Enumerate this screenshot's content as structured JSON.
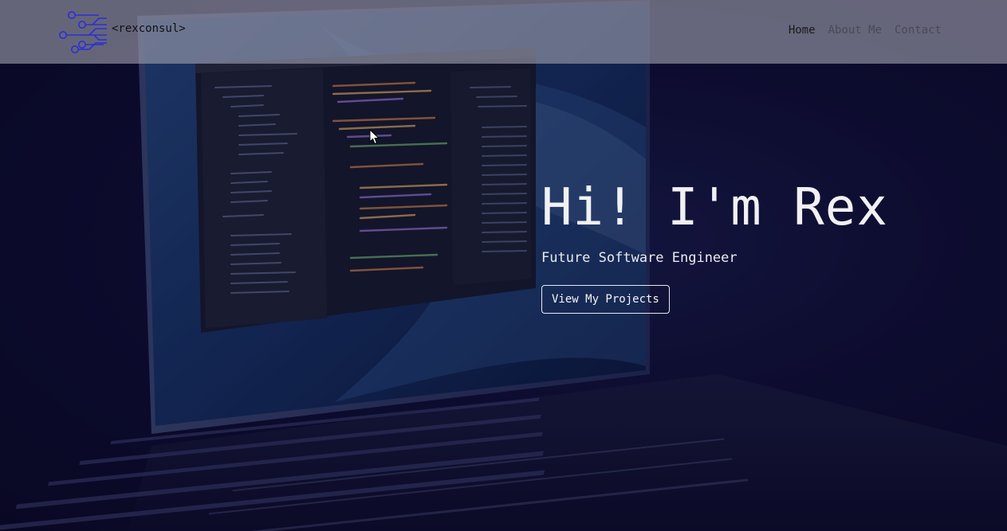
{
  "navbar": {
    "brand_text": "<rexconsul>",
    "logo_icon": "circuit-icon",
    "links": [
      {
        "label": "Home",
        "active": true
      },
      {
        "label": "About Me",
        "active": false
      },
      {
        "label": "Contact",
        "active": false
      }
    ]
  },
  "hero": {
    "title": "Hi! I'm Rex",
    "subtitle": "Future Software Engineer",
    "button_label": "View My Projects",
    "background_image": "laptop-code-photo"
  },
  "colors": {
    "background": "#0c0a27",
    "navbar": "#9e9eac",
    "logo": "#2b2fd6",
    "text_light": "#f1f1f4"
  }
}
